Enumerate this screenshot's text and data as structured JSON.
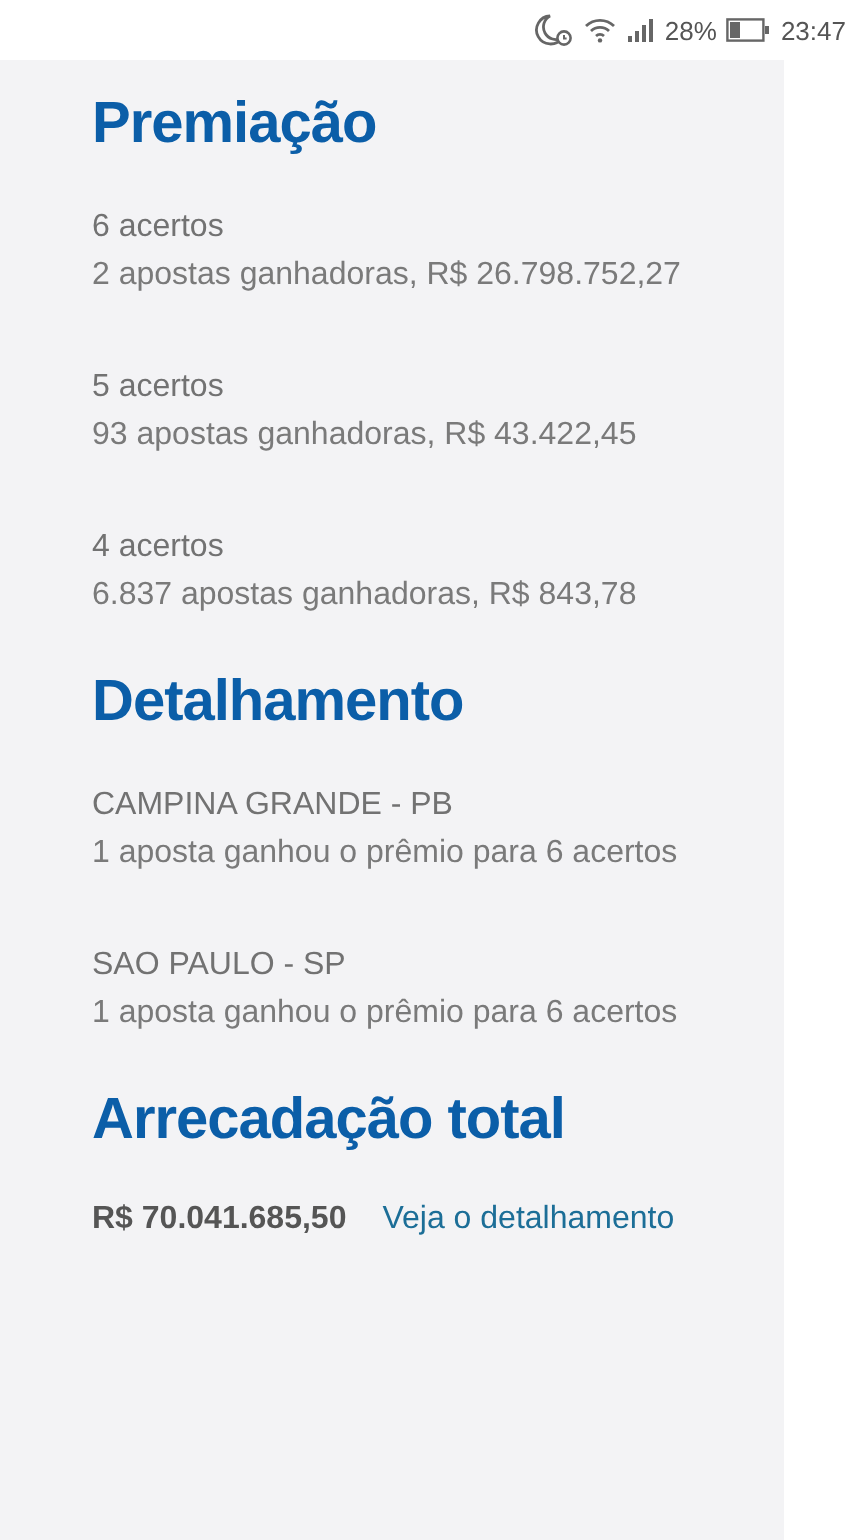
{
  "status_bar": {
    "battery_percent": "28%",
    "time": "23:47"
  },
  "sections": [
    {
      "title": "Premiação",
      "items": [
        {
          "heading": "6 acertos",
          "text": "2 apostas ganhadoras, R$ 26.798.752,27"
        },
        {
          "heading": "5 acertos",
          "text": "93 apostas ganhadoras, R$ 43.422,45"
        },
        {
          "heading": "4 acertos",
          "text": "6.837 apostas ganhadoras, R$ 843,78"
        }
      ]
    },
    {
      "title": "Detalhamento",
      "items": [
        {
          "heading": "CAMPINA GRANDE - PB",
          "text": "1 aposta ganhou o prêmio para 6 acertos"
        },
        {
          "heading": "SAO PAULO - SP",
          "text": "1 aposta ganhou o prêmio para 6 acertos"
        }
      ]
    },
    {
      "title": "Arrecadação total",
      "total": {
        "amount": "R$ 70.041.685,50",
        "link": "Veja o detalhamento"
      }
    }
  ]
}
